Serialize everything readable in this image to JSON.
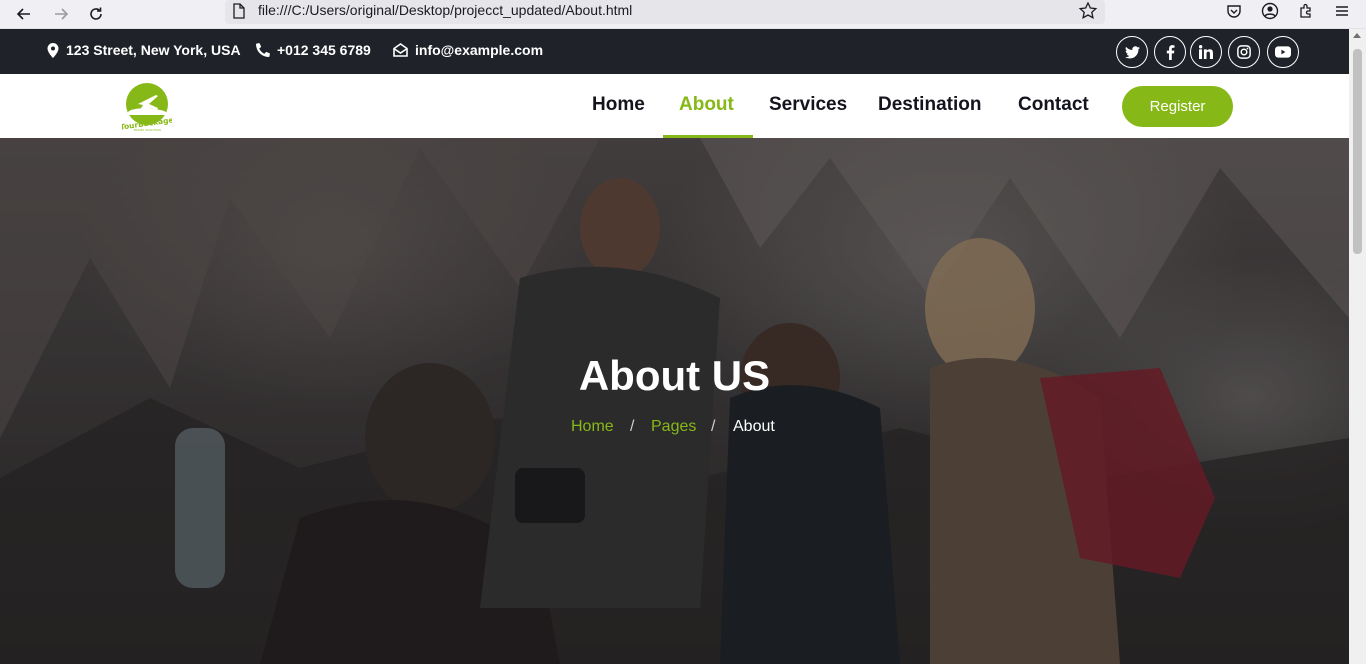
{
  "browser": {
    "url": "file:///C:/Users/original/Desktop/projecct_updated/About.html"
  },
  "topbar": {
    "address": "123 Street, New York, USA",
    "phone": "+012 345 6789",
    "email": "info@example.com",
    "social_icons": [
      "twitter-icon",
      "facebook-icon",
      "linkedin-icon",
      "instagram-icon",
      "youtube-icon"
    ]
  },
  "header": {
    "logo_text": "TourBackage",
    "logo_tagline": "TRAVEL SOLUTION",
    "nav": [
      "Home",
      "About",
      "Services",
      "Destination",
      "Contact"
    ],
    "active_nav": "About",
    "register_label": "Register"
  },
  "hero": {
    "title": "About US",
    "breadcrumb": {
      "home": "Home",
      "pages": "Pages",
      "current": "About",
      "separator": "/"
    }
  },
  "colors": {
    "accent": "#86b817",
    "topbar_bg": "#1f2229",
    "text_dark": "#14141f"
  }
}
